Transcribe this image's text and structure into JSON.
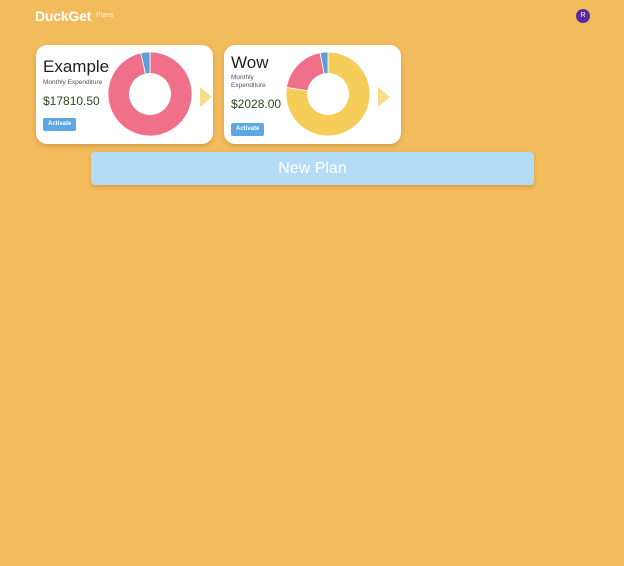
{
  "header": {
    "brand": "DuckGet",
    "nav_plans": "Plans",
    "avatar_initial": "R"
  },
  "plans": [
    {
      "name": "Example",
      "subtitle": "Monthly Expenditure",
      "amount": "$17810.50",
      "activate_label": "Activate",
      "chart_data": {
        "type": "pie",
        "values": [
          96.5,
          3.5
        ],
        "colors": [
          "#ef7088",
          "#5a9fd8"
        ]
      }
    },
    {
      "name": "Wow",
      "subtitle": "Monthly Expenditure",
      "amount": "$2028.00",
      "activate_label": "Activate",
      "chart_data": {
        "type": "pie",
        "values": [
          77.5,
          19.5,
          3.0
        ],
        "colors": [
          "#f7cd5a",
          "#ef7088",
          "#5a9fd8"
        ]
      }
    }
  ],
  "new_plan_label": "New Plan",
  "colors": {
    "background": "#f2bb5c",
    "card": "#ffffff",
    "accent_button": "#5da8e3",
    "new_plan_button": "#b5dcf7",
    "avatar": "#5b2aa0",
    "arrow": "#f7dc8a"
  },
  "icons": {
    "next": "chevron-right-icon"
  }
}
